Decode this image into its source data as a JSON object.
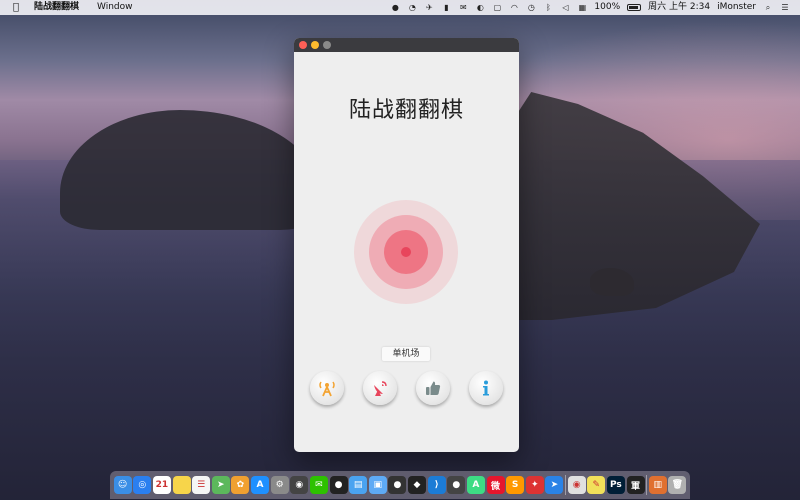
{
  "menubar": {
    "apple_icon": "apple-icon",
    "app_name": "陆战翻翻棋",
    "menu_window": "Window",
    "battery_percent": "100%",
    "datetime": "周六 上午 2:34",
    "user": "iMonster"
  },
  "window": {
    "title": "陆战翻翻棋",
    "mode_label": "单机场",
    "buttons": [
      "online-play-icon",
      "radar-dish-icon",
      "thumbs-up-icon",
      "info-icon"
    ],
    "accent": "#e8455c"
  },
  "dock": {
    "apps": [
      {
        "icon": "finder-icon",
        "color": "#3a8ee6",
        "glyph": "☺"
      },
      {
        "icon": "safari-icon",
        "color": "#2a7ff0",
        "glyph": "◎"
      },
      {
        "icon": "calendar-icon",
        "color": "#ffffff",
        "glyph": "21"
      },
      {
        "icon": "notes-icon",
        "color": "#f7d54a",
        "glyph": ""
      },
      {
        "icon": "reminders-icon",
        "color": "#f5f5f5",
        "glyph": "☰"
      },
      {
        "icon": "maps-icon",
        "color": "#5cb85c",
        "glyph": "➤"
      },
      {
        "icon": "photos-icon",
        "color": "#f0a030",
        "glyph": "✿"
      },
      {
        "icon": "app-store-icon",
        "color": "#1e90ff",
        "glyph": "A"
      },
      {
        "icon": "system-preferences-icon",
        "color": "#8a8a8a",
        "glyph": "⚙"
      },
      {
        "icon": "camera-icon",
        "color": "#444",
        "glyph": "◉"
      },
      {
        "icon": "wechat-icon",
        "color": "#2dc100",
        "glyph": "✉"
      },
      {
        "icon": "qq-icon",
        "color": "#222",
        "glyph": "●"
      },
      {
        "icon": "files-icon",
        "color": "#4aa3f0",
        "glyph": "▤"
      },
      {
        "icon": "folder-icon",
        "color": "#5eaaf5",
        "glyph": "▣"
      },
      {
        "icon": "penguin-icon",
        "color": "#333",
        "glyph": "●"
      },
      {
        "icon": "unity-icon",
        "color": "#222",
        "glyph": "◆"
      },
      {
        "icon": "vscode-icon",
        "color": "#1c7cd6",
        "glyph": "⟩"
      },
      {
        "icon": "drop-icon",
        "color": "#444",
        "glyph": "●"
      },
      {
        "icon": "android-studio-icon",
        "color": "#3ddc84",
        "glyph": "A"
      },
      {
        "icon": "weibo-icon",
        "color": "#e6162d",
        "glyph": "微"
      },
      {
        "icon": "sublime-icon",
        "color": "#ff9800",
        "glyph": "S"
      },
      {
        "icon": "parrot-icon",
        "color": "#d33",
        "glyph": "✦"
      },
      {
        "icon": "navigation-icon",
        "color": "#2a82e6",
        "glyph": "➤"
      },
      {
        "icon": "chrome-icon",
        "color": "#e0e0e0",
        "glyph": "◉"
      },
      {
        "icon": "stickies-icon",
        "color": "#f1e05a",
        "glyph": "✎"
      },
      {
        "icon": "photoshop-icon",
        "color": "#001e36",
        "glyph": "Ps"
      },
      {
        "icon": "army-chess-icon",
        "color": "#222",
        "glyph": "軍"
      },
      {
        "icon": "documents-icon",
        "color": "#e07030",
        "glyph": "▥"
      },
      {
        "icon": "trash-icon",
        "color": "#b0b0b0",
        "glyph": "🗑"
      }
    ]
  }
}
